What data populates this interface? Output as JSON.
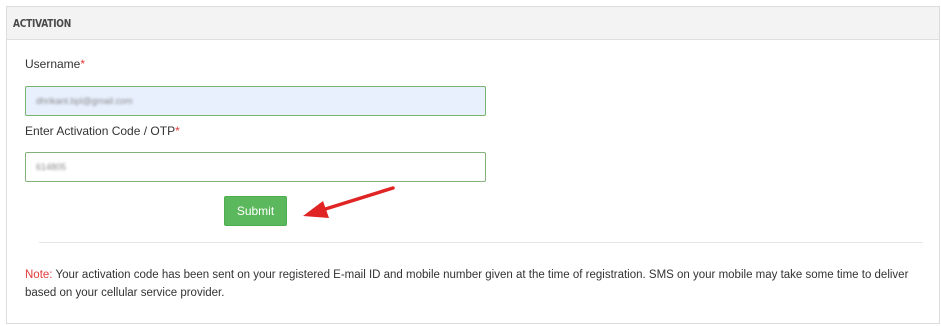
{
  "panel": {
    "title": "ACTIVATION"
  },
  "form": {
    "username": {
      "label": "Username",
      "required_mark": "*",
      "value": "dhrikant.bpl@gmail.com"
    },
    "otp": {
      "label": "Enter Activation Code / OTP",
      "required_mark": "*",
      "value": "614805"
    },
    "submit_label": "Submit"
  },
  "note": {
    "label": "Note:",
    "text": " Your activation code has been sent on your registered E-mail ID and mobile number given at the time of registration. SMS on your mobile may take some time to deliver based on your cellular service provider."
  },
  "colors": {
    "accent_green": "#5cb85c",
    "required_red": "#e23b3b",
    "annotation_arrow": "#e02424"
  },
  "icons": {
    "annotation": "arrow-left-icon"
  }
}
